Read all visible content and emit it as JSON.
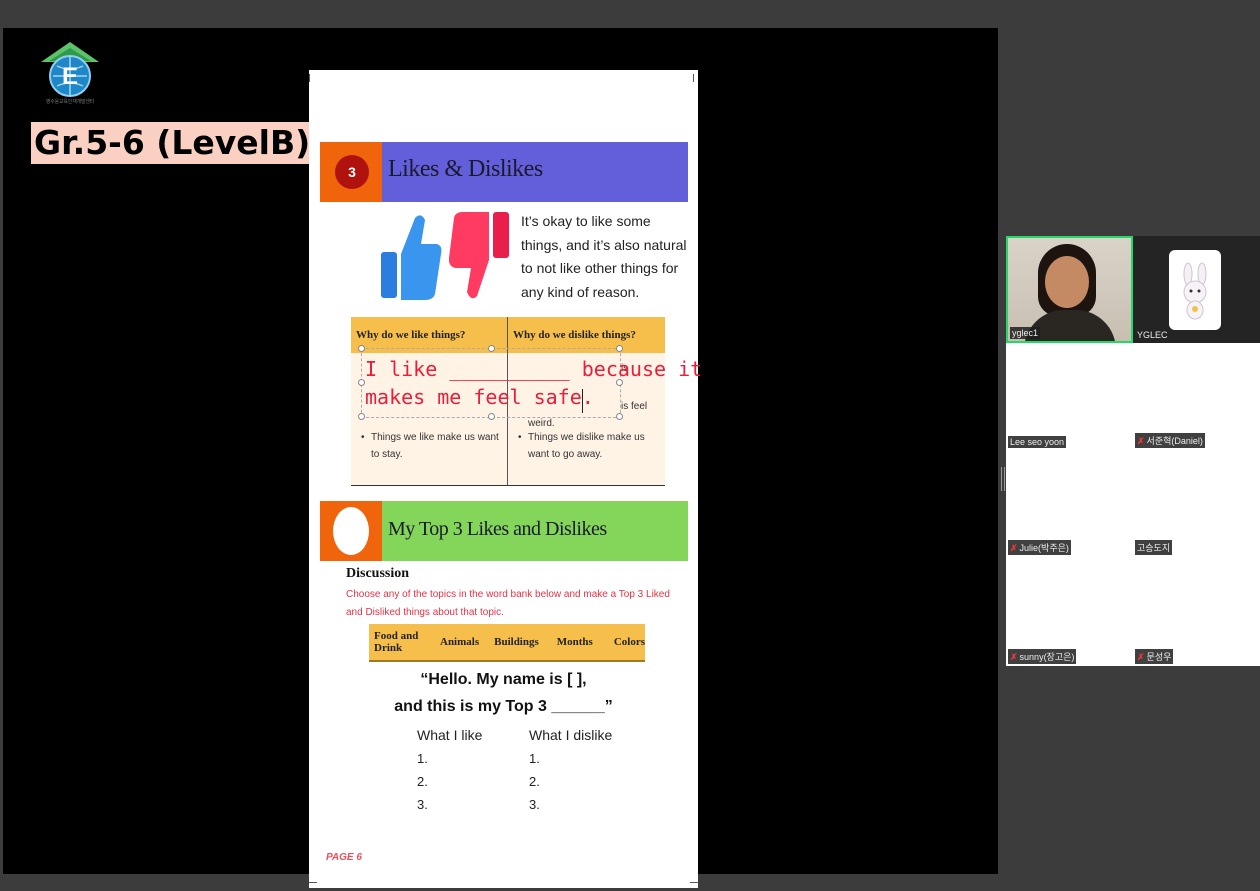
{
  "header": {
    "grade_label": "Gr.5-6 (LevelB)",
    "logo_caption": "영수윤교육인재개발센터"
  },
  "document": {
    "section1": {
      "number": "3",
      "title": "Likes & Dislikes",
      "bar_color": "#635ed9",
      "intro": "It’s okay to like some things, and it’s also natural to not like other things for any kind of reason."
    },
    "table": {
      "col1_header": "Why do we like things?",
      "col2_header": "Why do we dislike things?",
      "fragment_1": "is",
      "fragment_2": "is feel",
      "fragment_3": "weird.",
      "col1_bullet": "Things we like make us want to stay.",
      "col2_bullet": "Things we dislike make us want to go away."
    },
    "text_box": {
      "line1": "I like __________ because it",
      "line2": "makes me feel safe."
    },
    "section2": {
      "title": "My Top 3 Likes and Dislikes",
      "bar_color": "#84d65b"
    },
    "discussion": {
      "heading": "Discussion",
      "description": "Choose any of the topics in the word bank below and make a Top 3 Liked and Disliked things about that topic."
    },
    "word_bank": [
      "Food and Drink",
      "Animals",
      "Buildings",
      "Months",
      "Colors"
    ],
    "prompt": {
      "line1": "“Hello. My name is [ ],",
      "line2": "and this is my Top 3 ______”"
    },
    "columns": {
      "like_header": "What I like",
      "dislike_header": "What I dislike",
      "items": [
        "1.",
        "2.",
        "3."
      ]
    },
    "page_number": "PAGE 6"
  },
  "participants": [
    {
      "name": "yglec1",
      "muted": false,
      "video": true
    },
    {
      "name": "YGLEC",
      "muted": false,
      "video": false
    },
    {
      "name": "Lee seo yoon",
      "muted": false,
      "video": false
    },
    {
      "name": "서준혁(Daniel)",
      "muted": true,
      "video": false
    },
    {
      "name": "Julie(박주은)",
      "muted": true,
      "video": false
    },
    {
      "name": "고승도지",
      "muted": false,
      "video": false
    },
    {
      "name": "sunny(장고은)",
      "muted": true,
      "video": false
    },
    {
      "name": "문성우",
      "muted": true,
      "video": false
    }
  ]
}
